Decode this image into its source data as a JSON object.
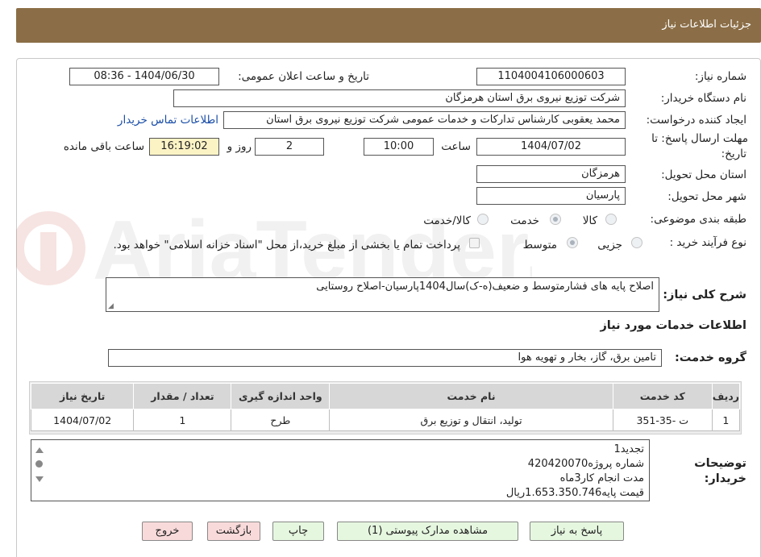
{
  "header": {
    "title": "جزئیات اطلاعات نیاز"
  },
  "watermark": {
    "brand": "AriaTender.neT"
  },
  "form": {
    "need_number": {
      "label": "شماره نیاز:",
      "value": "1104004106000603"
    },
    "announce_datetime": {
      "label": "تاریخ و ساعت اعلان عمومی:",
      "value": "1404/06/30 - 08:36"
    },
    "buyer_org": {
      "label": "نام دستگاه خریدار:",
      "value": "شرکت توزیع نیروی برق استان هرمزگان"
    },
    "requester": {
      "label": "ایجاد کننده درخواست:",
      "value": "محمد یعقوبی کارشناس تدارکات و خدمات عمومی شرکت توزیع نیروی برق استان",
      "contact_link": "اطلاعات تماس خریدار"
    },
    "deadline": {
      "label_line1": "مهلت ارسال پاسخ: تا",
      "label_line2": "تاریخ:",
      "date": "1404/07/02",
      "time_label": "ساعت",
      "time": "10:00",
      "days": "2",
      "days_label": "روز و",
      "remaining": "16:19:02",
      "remaining_label": "ساعت باقی مانده"
    },
    "province": {
      "label": "استان محل تحویل:",
      "value": "هرمزگان"
    },
    "city": {
      "label": "شهر محل تحویل:",
      "value": "پارسیان"
    },
    "category": {
      "label": "طبقه بندی موضوعی:",
      "options": [
        "کالا",
        "خدمت",
        "کالا/خدمت"
      ],
      "selected": "خدمت"
    },
    "purchase_process": {
      "label": "نوع فرآیند خرید :",
      "options": [
        "جزیی",
        "متوسط"
      ],
      "selected": "متوسط",
      "treasury_note": "پرداخت تمام یا بخشی از مبلغ خرید،از محل \"اسناد خزانه اسلامی\" خواهد بود."
    },
    "general_description": {
      "label": "شرح کلی نیاز:",
      "value": "اصلاح پایه های فشارمتوسط و ضعیف(ه-ک)سال1404پارسیان-اصلاح روستایی"
    },
    "services_section_title": "اطلاعات خدمات مورد نیاز",
    "service_group": {
      "label": "گروه خدمت:",
      "value": "تامین برق، گاز، بخار و تهویه هوا"
    }
  },
  "table": {
    "headers": [
      "ردیف",
      "کد خدمت",
      "نام خدمت",
      "واحد اندازه گیری",
      "تعداد / مقدار",
      "تاریخ نیاز"
    ],
    "rows": [
      [
        "1",
        "ت -35-351",
        "تولید، انتقال و توزیع برق",
        "طرح",
        "1",
        "1404/07/02"
      ]
    ]
  },
  "buyer_notes": {
    "label_line1": "توضیحات",
    "label_line2": "خریدار:",
    "lines": [
      "تجدید1",
      "شماره پروژه420420070",
      "مدت انجام کار3ماه",
      "قیمت پایه1.653.350.746ریال"
    ]
  },
  "buttons": {
    "reply": "پاسخ به نیاز",
    "attachments": "مشاهده مدارک پیوستی (1)",
    "print": "چاپ",
    "back": "بازگشت",
    "exit": "خروج"
  },
  "colors": {
    "header_bg": "#8b6e47",
    "remaining_bg": "#fcf3c5",
    "button_green": "#e6f7e0",
    "button_pink": "#f9dada",
    "link": "#1a4ea8"
  }
}
